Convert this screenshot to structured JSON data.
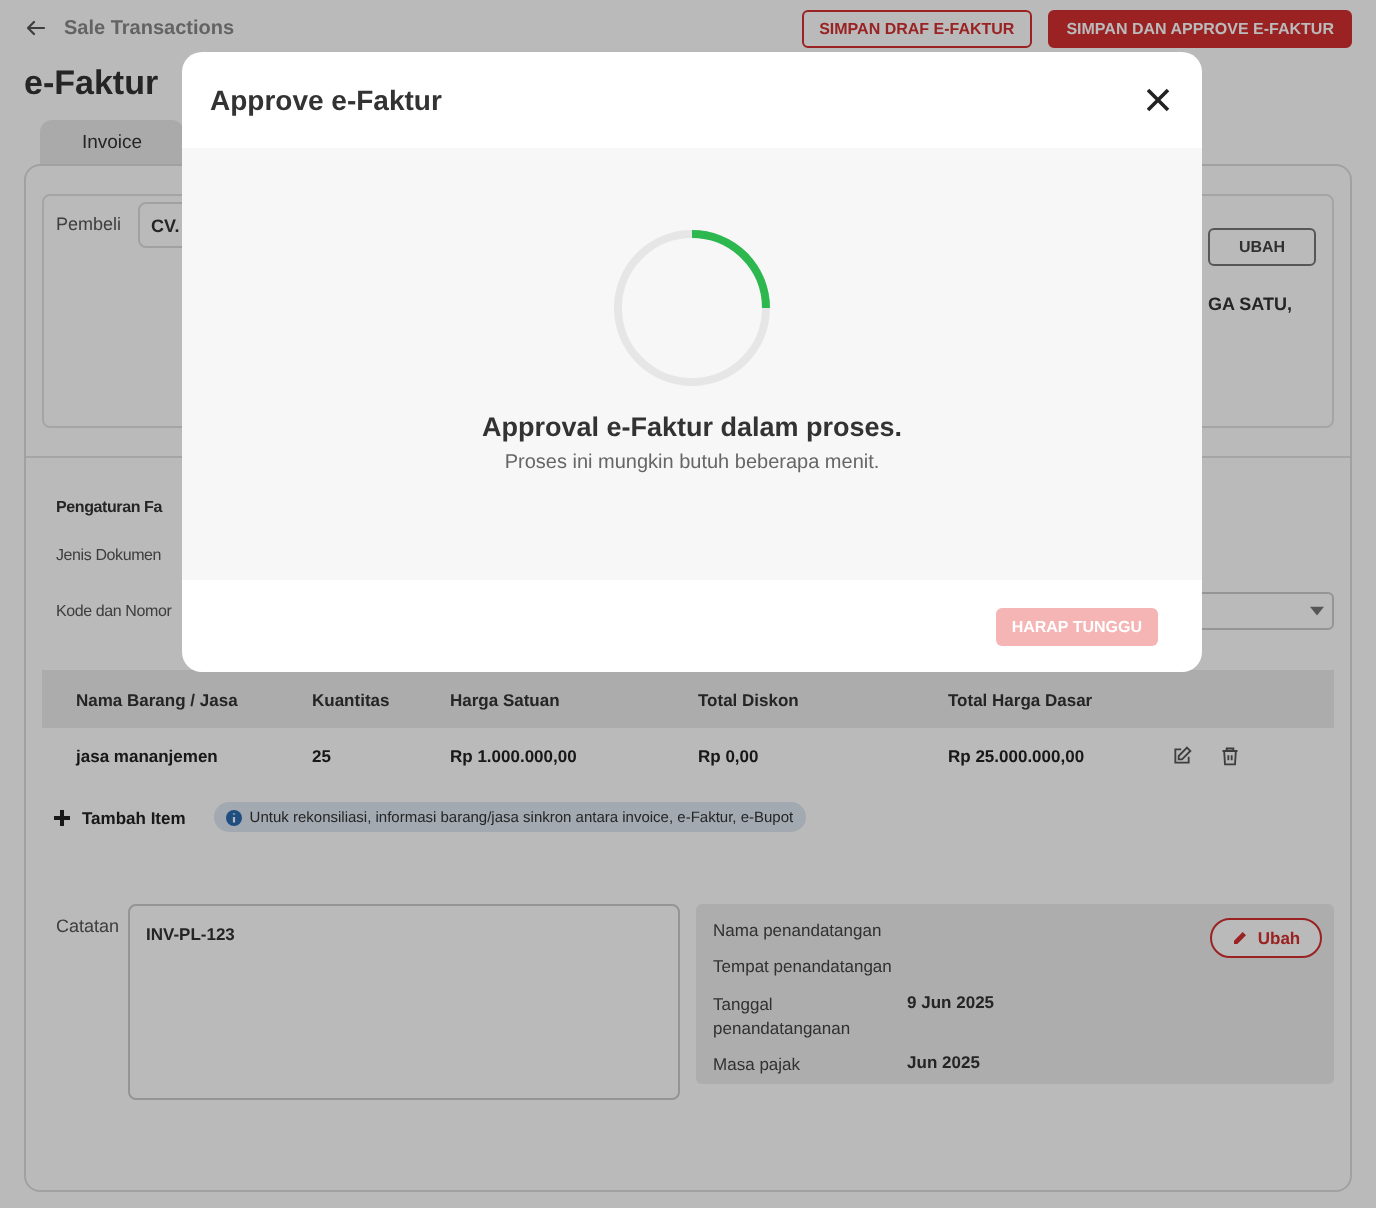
{
  "header": {
    "back_label": "Sale Transactions",
    "buttons": [
      {
        "label": "SIMPAN DRAF E-FAKTUR",
        "kind": "outline"
      },
      {
        "label": "SIMPAN DAN APPROVE E-FAKTUR",
        "kind": "primary"
      }
    ]
  },
  "page_title": "e-Faktur",
  "tabs": [
    {
      "label": "Invoice",
      "selected": true
    }
  ],
  "buyer": {
    "label": "Pembeli",
    "value": "CV.",
    "change_button": "UBAH",
    "address_fragment": "GA SATU,"
  },
  "settings": {
    "title": "Pengaturan Fa",
    "fields": [
      {
        "label": "Jenis Dokumen",
        "kind": "text"
      },
      {
        "label": "Kode dan Nomor",
        "kind": "select"
      }
    ]
  },
  "table": {
    "columns": [
      "Nama Barang / Jasa",
      "Kuantitas",
      "Harga Satuan",
      "Total Diskon",
      "Total Harga Dasar"
    ],
    "rows": [
      {
        "cells": [
          "jasa mananjemen",
          "25",
          "Rp 1.000.000,00",
          "Rp 0,00",
          "Rp 25.000.000,00"
        ]
      }
    ]
  },
  "add_item": "Tambah Item",
  "info": "Untuk rekonsiliasi, informasi barang/jasa sinkron antara invoice, e-Faktur, e-Bupot",
  "notes": {
    "label": "Catatan",
    "value": "INV-PL-123"
  },
  "signer": {
    "edit_button": "Ubah",
    "fields": [
      {
        "label": "Nama penandatangan"
      },
      {
        "label": "Tempat penandatangan"
      },
      {
        "label": "Tanggal penandatanganan",
        "value": "9 Jun 2025"
      },
      {
        "label": "Masa pajak",
        "value": "Jun 2025"
      }
    ]
  },
  "modal": {
    "title": "Approve e-Faktur",
    "heading": "Approval e-Faktur dalam proses.",
    "message": "Proses ini mungkin butuh beberapa menit.",
    "button": {
      "label": "HARAP TUNGGU",
      "disabled": true
    }
  }
}
